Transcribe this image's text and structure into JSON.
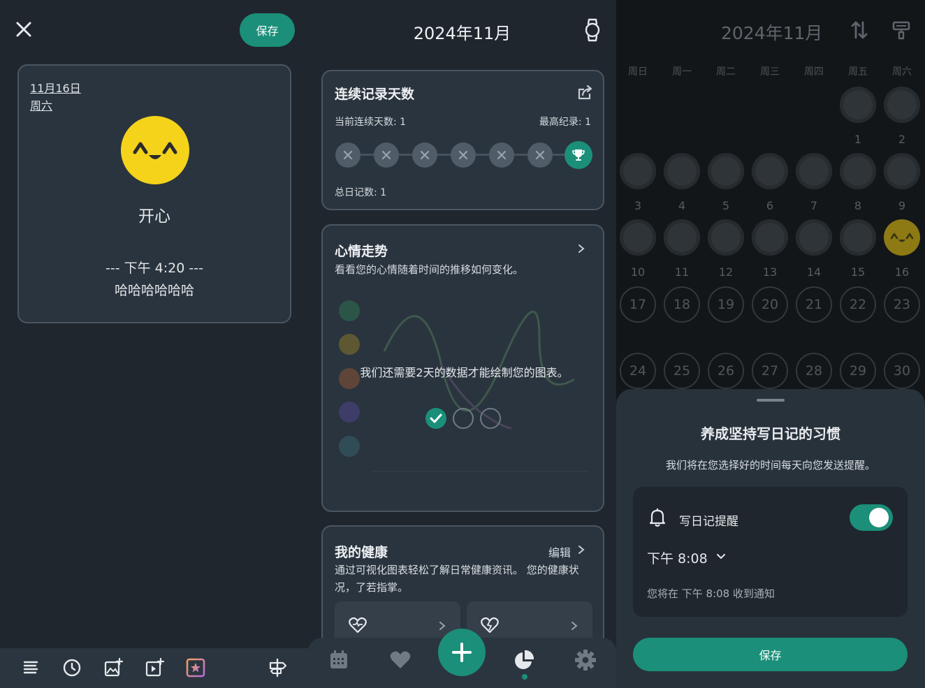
{
  "editor": {
    "save_label": "保存",
    "date_line": "11月16日",
    "weekday_line": "周六",
    "mood": "开心",
    "time": "--- 下午 4:20 ---",
    "text": "哈哈哈哈哈哈"
  },
  "stats": {
    "title": "2024年11月",
    "streak": {
      "title": "连续记录天数",
      "current_label": "当前连续天数: 1",
      "best_label": "最高纪录: 1",
      "total_label": "总日记数: 1",
      "days_done": 1,
      "days_total": 7
    },
    "trend": {
      "title": "心情走势",
      "subtitle": "看看您的心情随着时间的推移如何变化。",
      "need_msg": "我们还需要2天的数据才能绘制您的图表。",
      "progress_done": 1,
      "progress_total": 3
    },
    "health": {
      "title": "我的健康",
      "edit_label": "编辑",
      "subtitle": "通过可视化图表轻松了解日常健康资讯。 您的健康状况，了若指掌。"
    }
  },
  "calendar": {
    "title": "2024年11月",
    "weekdays": [
      "周日",
      "周一",
      "周二",
      "周三",
      "周四",
      "周五",
      "周六"
    ],
    "days": [
      "1",
      "2",
      "3",
      "4",
      "5",
      "6",
      "7",
      "8",
      "9",
      "10",
      "11",
      "12",
      "13",
      "14",
      "15",
      "16",
      "17",
      "18",
      "19",
      "20",
      "21",
      "22",
      "23",
      "24",
      "25",
      "26",
      "27",
      "28",
      "29",
      "30"
    ],
    "mood_day": "16"
  },
  "reminder_sheet": {
    "title": "养成坚持写日记的习惯",
    "subtitle": "我们将在您选择好的时间每天向您发送提醒。",
    "reminder_label": "写日记提醒",
    "enabled": true,
    "time": "下午 8:08",
    "note": "您将在 下午 8:08 收到通知",
    "save_label": "保存"
  },
  "colors": {
    "accent": "#1b8f79",
    "mood_yellow": "#f5d31b",
    "card_bg": "#2a343e"
  }
}
